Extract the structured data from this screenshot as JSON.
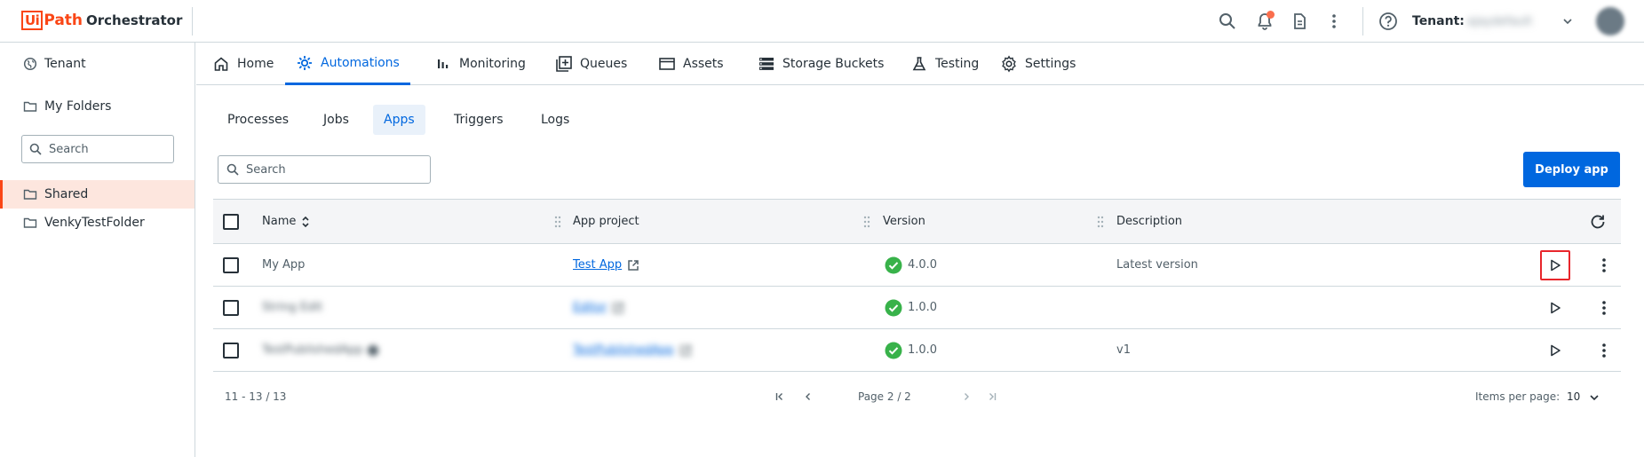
{
  "header": {
    "logo_box": "Ui",
    "logo_path": "Path",
    "product": "Orchestrator",
    "tenant_label": "Tenant:",
    "tenant_value": "ajaydefault"
  },
  "sidebar": {
    "tenant": "Tenant",
    "my_folders": "My Folders",
    "search_placeholder": "Search",
    "folders": [
      {
        "label": "Shared",
        "active": true
      },
      {
        "label": "VenkyTestFolder",
        "active": false
      }
    ]
  },
  "top_tabs": [
    {
      "label": "Home",
      "icon": "home-icon"
    },
    {
      "label": "Automations",
      "icon": "automations-icon",
      "active": true
    },
    {
      "label": "Monitoring",
      "icon": "monitoring-icon"
    },
    {
      "label": "Queues",
      "icon": "queues-icon"
    },
    {
      "label": "Assets",
      "icon": "assets-icon"
    },
    {
      "label": "Storage Buckets",
      "icon": "storage-icon"
    },
    {
      "label": "Testing",
      "icon": "testing-icon"
    },
    {
      "label": "Settings",
      "icon": "gear-icon"
    }
  ],
  "sub_tabs": [
    {
      "label": "Processes"
    },
    {
      "label": "Jobs"
    },
    {
      "label": "Apps",
      "active": true
    },
    {
      "label": "Triggers"
    },
    {
      "label": "Logs"
    }
  ],
  "search_placeholder": "Search",
  "deploy_label": "Deploy app",
  "table": {
    "columns": [
      "Name",
      "App project",
      "Version",
      "Description"
    ],
    "rows": [
      {
        "name": "My App",
        "project": "Test App",
        "version": "4.0.0",
        "description": "Latest version",
        "blurred": false
      },
      {
        "name": "String Edit",
        "project": "Editor",
        "version": "1.0.0",
        "description": "",
        "blurred": true
      },
      {
        "name": "TestPublishedApp",
        "project": "TestPublishedApp",
        "version": "1.0.0",
        "description": "v1",
        "blurred": true
      }
    ]
  },
  "footer": {
    "range": "11 - 13 / 13",
    "page": "Page 2 / 2",
    "items_label": "Items per page:",
    "items_value": "10"
  },
  "colors": {
    "accent": "#0067df",
    "brand": "#fa4616",
    "success": "#38b24a",
    "highlight": "#e8262c"
  }
}
